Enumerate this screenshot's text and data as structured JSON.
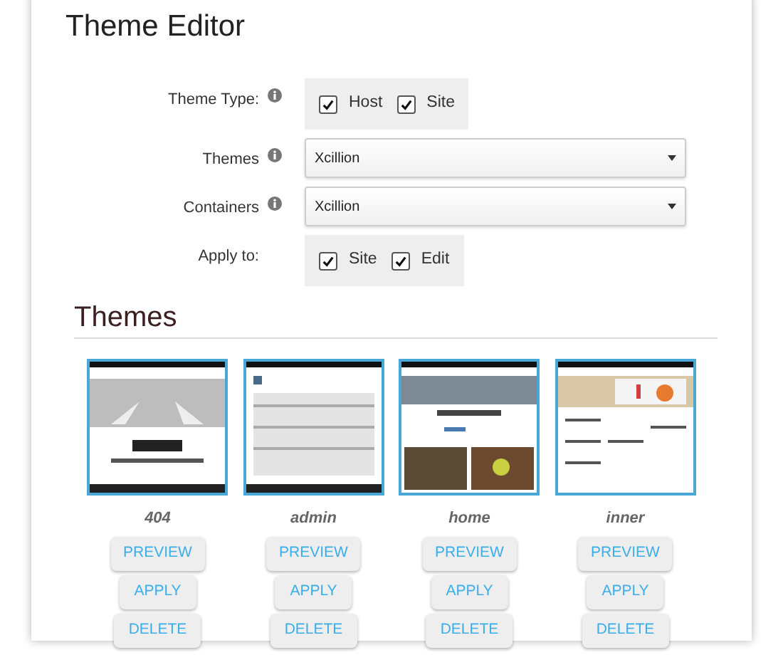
{
  "title": "Theme Editor",
  "form": [
    {
      "kind": "checks",
      "label": "Theme Type:",
      "info": true,
      "options": [
        {
          "label": "Host",
          "checked": true
        },
        {
          "label": "Site",
          "checked": true
        }
      ]
    },
    {
      "kind": "select",
      "label": "Themes",
      "info": true,
      "value": "Xcillion"
    },
    {
      "kind": "select",
      "label": "Containers",
      "info": true,
      "value": "Xcillion"
    },
    {
      "kind": "checks",
      "label": "Apply to:",
      "info": false,
      "options": [
        {
          "label": "Site",
          "checked": true
        },
        {
          "label": "Edit",
          "checked": true
        }
      ]
    }
  ],
  "themes_heading": "Themes",
  "themes": [
    {
      "name": "404",
      "thumbnail": {
        "kind": "picture"
      },
      "buttons": [
        "PREVIEW",
        "APPLY",
        "DELETE"
      ]
    },
    {
      "name": "admin",
      "thumbnail": {
        "kind": "picture"
      },
      "buttons": [
        "PREVIEW",
        "APPLY",
        "DELETE"
      ]
    },
    {
      "name": "home",
      "thumbnail": {
        "kind": "picture"
      },
      "buttons": [
        "PREVIEW",
        "APPLY",
        "DELETE"
      ]
    },
    {
      "name": "inner",
      "thumbnail": {
        "kind": "picture"
      },
      "buttons": [
        "PREVIEW",
        "APPLY",
        "DELETE"
      ]
    }
  ]
}
